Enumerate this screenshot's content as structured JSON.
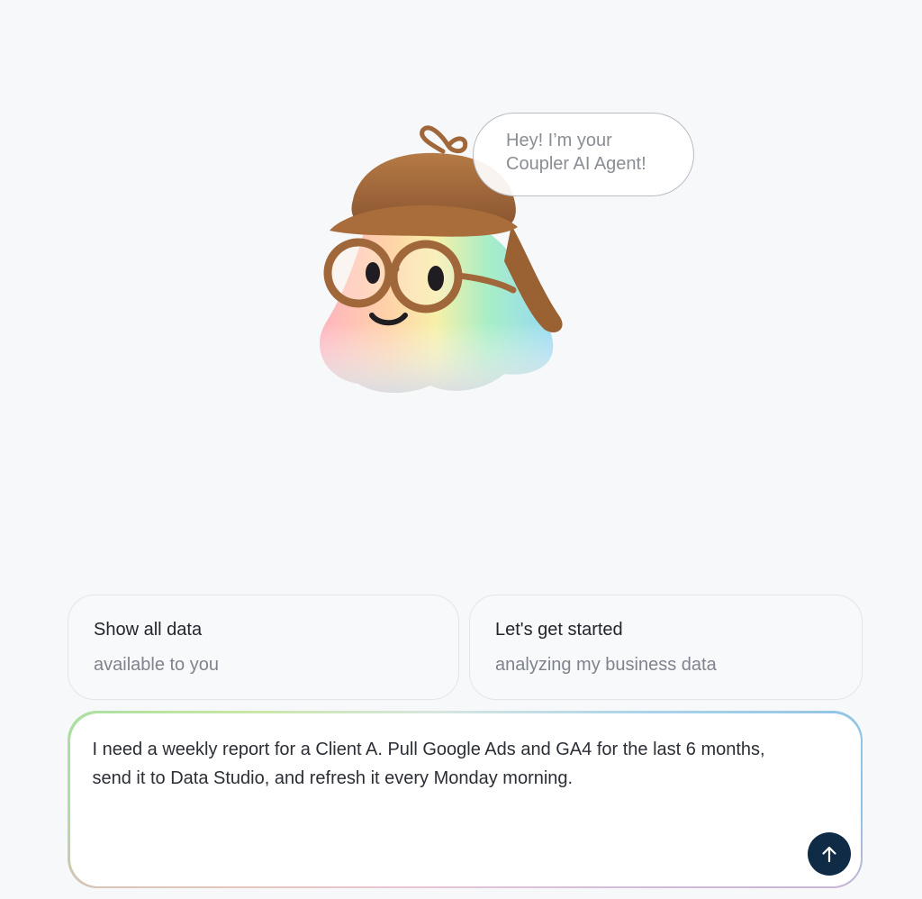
{
  "mascot": {
    "icon": "detective-cloud-mascot-icon",
    "greeting_line1": "Hey! I’m your",
    "greeting_line2": "Coupler AI Agent!"
  },
  "suggestions": [
    {
      "title": "Show all data",
      "subtitle": "available to you"
    },
    {
      "title": "Let's get started",
      "subtitle": "analyzing my business data"
    }
  ],
  "composer": {
    "text": "I need a weekly report for a Client A. Pull Google Ads and GA4 for the last 6 months, send it to Data Studio, and refresh it every Monday morning.",
    "send_icon": "arrow-up-icon"
  },
  "colors": {
    "background": "#f7f8fa",
    "send_button": "#0f2b45",
    "hat": "#a0683a"
  }
}
